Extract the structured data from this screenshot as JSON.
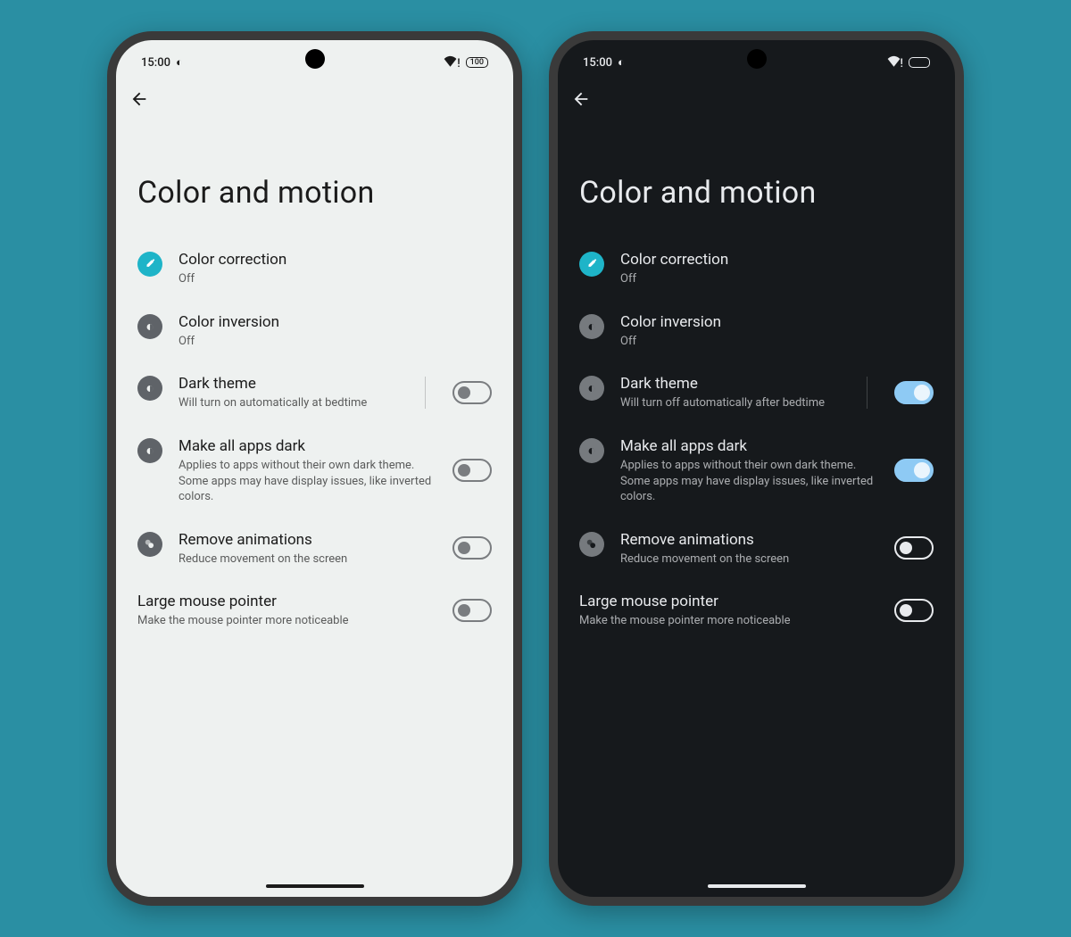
{
  "status": {
    "time": "15:00",
    "battery_light": "100",
    "battery_dark": ""
  },
  "title": "Color and motion",
  "items": {
    "color_correction": {
      "label": "Color correction",
      "sub": "Off"
    },
    "color_inversion": {
      "label": "Color inversion",
      "sub": "Off"
    },
    "dark_theme": {
      "label": "Dark theme",
      "sub_light": "Will turn on automatically at bedtime",
      "sub_dark": "Will turn off automatically after bedtime"
    },
    "make_dark": {
      "label": "Make all apps dark",
      "sub": "Applies to apps without their own dark theme. Some apps may have display issues, like inverted colors."
    },
    "remove_anim": {
      "label": "Remove animations",
      "sub": "Reduce movement on the screen"
    },
    "large_pointer": {
      "label": "Large mouse pointer",
      "sub": "Make the mouse pointer more noticeable"
    }
  }
}
